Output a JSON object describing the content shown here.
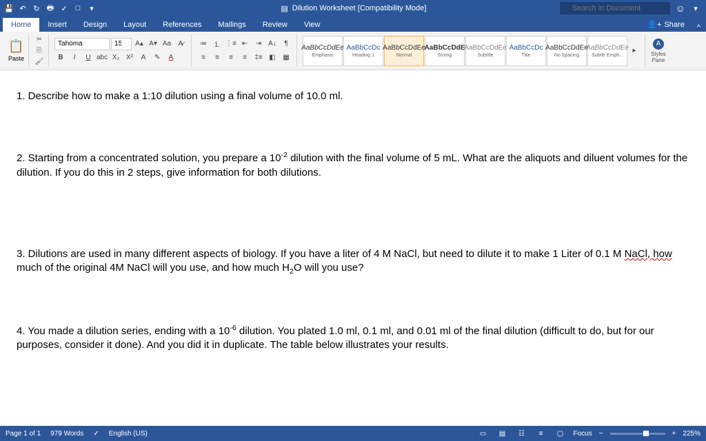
{
  "titlebar": {
    "title": "Dilution Worksheet [Compatibility Mode]",
    "search_placeholder": "Search in Document"
  },
  "tabs": {
    "items": [
      "Home",
      "Insert",
      "Design",
      "Layout",
      "References",
      "Mailings",
      "Review",
      "View"
    ],
    "active": 0,
    "share": "Share"
  },
  "ribbon": {
    "paste": "Paste",
    "font_name": "Tahoma",
    "font_size": "15",
    "styles": [
      {
        "sample": "AaBbCcDdEe",
        "label": "Emphasis"
      },
      {
        "sample": "AaBbCcDc",
        "label": "Heading 1"
      },
      {
        "sample": "AaBbCcDdEe",
        "label": "Normal"
      },
      {
        "sample": "AaBbCcDdE",
        "label": "Strong"
      },
      {
        "sample": "AaBbCcDdEe",
        "label": "Subtitle"
      },
      {
        "sample": "AaBbCcDc",
        "label": "Title"
      },
      {
        "sample": "AaBbCcDdEe",
        "label": "No Spacing"
      },
      {
        "sample": "AaBbCcDdEe",
        "label": "Subtle Emph..."
      }
    ],
    "styles_pane": "Styles\nPane"
  },
  "document": {
    "q1": "1.  Describe how to make a 1:10 dilution using a final volume of 10.0 ml.",
    "q2a": "2.  Starting from a concentrated solution, you prepare a 10",
    "q2_exp": "-2",
    "q2b": " dilution with the final volume of 5 mL.  What are the aliquots and diluent volumes for the dilution.  If you do this in 2 steps, give information for both dilutions.",
    "q3a": "3.  Dilutions are used in many different aspects of biology.  If you have a liter of 4 M NaCl, but need to dilute it to make 1 Liter of 0.1 M ",
    "q3_wavy": "NaCl,  how",
    "q3b": " much of the original 4M NaCl will you use, and how much H",
    "q3_sub": "2",
    "q3c": "O will you use?",
    "q4a": "4.  You made a dilution series, ending with a 10",
    "q4_exp": "-6",
    "q4b": " dilution.  You plated 1.0 ml, 0.1 ml, and 0.01 ml of the final dilution (difficult to do, but for our purposes, consider it done).   And you did it in duplicate. The table below illustrates your results."
  },
  "statusbar": {
    "page": "Page 1 of 1",
    "words": "979 Words",
    "lang": "English (US)",
    "focus": "Focus",
    "zoom": "225%",
    "minus": "−",
    "plus": "+"
  }
}
